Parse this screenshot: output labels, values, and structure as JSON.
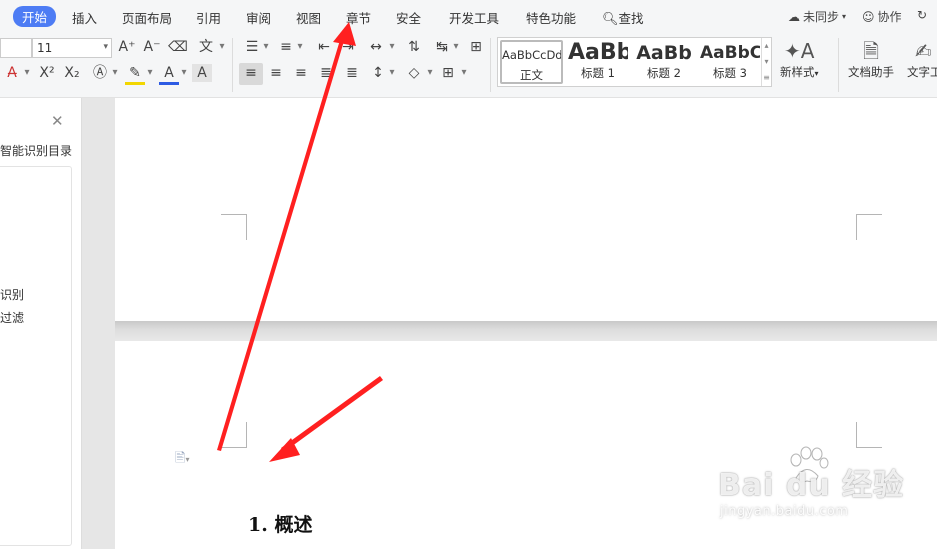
{
  "menu": {
    "items": [
      "开始",
      "插入",
      "页面布局",
      "引用",
      "审阅",
      "视图",
      "章节",
      "安全",
      "开发工具",
      "特色功能"
    ],
    "search_label": "查找",
    "sync_label": "未同步",
    "collab_label": "协作",
    "accent_color": "#4d7cf4"
  },
  "toolbar": {
    "font_name": "",
    "font_size": "11",
    "styles": [
      {
        "sample": "AaBbCcDd",
        "name": "正文"
      },
      {
        "sample": "AaBb",
        "name": "标题 1"
      },
      {
        "sample": "AaBb",
        "name": "标题 2"
      },
      {
        "sample": "AaBbC",
        "name": "标题 3"
      }
    ],
    "new_style_label": "新样式",
    "doc_helper_label": "文档助手",
    "text_tools_label": "文字工"
  },
  "left_panel": {
    "title": "智能识别目录",
    "line1": "识别",
    "line2": "过滤"
  },
  "document": {
    "heading": "1.  概述"
  },
  "watermark": {
    "logo_text": "Bai du 经验",
    "url": "jingyan.baidu.com"
  }
}
